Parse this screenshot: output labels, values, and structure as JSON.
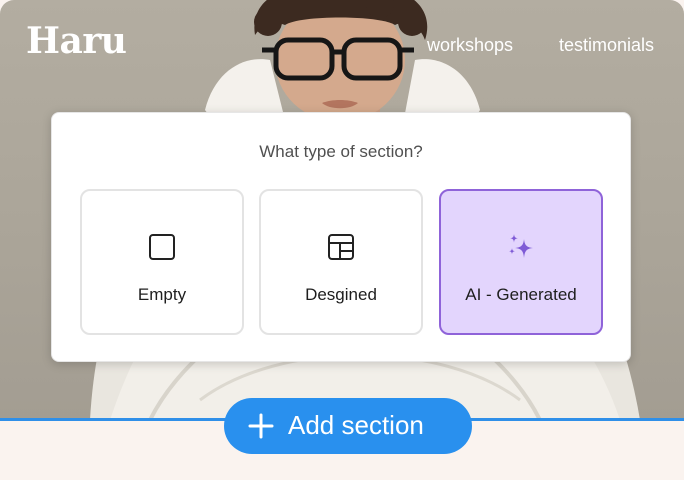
{
  "brand": {
    "name": "Haru"
  },
  "nav": {
    "items": [
      {
        "label": "workshops"
      },
      {
        "label": "testimonials"
      }
    ]
  },
  "dialog": {
    "title": "What type of section?",
    "options": [
      {
        "label": "Empty",
        "icon": "square-icon",
        "selected": false
      },
      {
        "label": "Desgined",
        "icon": "layout-grid-icon",
        "selected": false
      },
      {
        "label": "AI - Generated",
        "icon": "sparkles-icon",
        "selected": true
      }
    ]
  },
  "add_section": {
    "label": "Add section",
    "icon": "plus-icon"
  },
  "colors": {
    "accent_blue": "#2990ee",
    "selected_bg": "#e3d5fd",
    "selected_border": "#8f63d9",
    "sparkle": "#7f5bd6",
    "footer_bg": "#faf3ef"
  }
}
